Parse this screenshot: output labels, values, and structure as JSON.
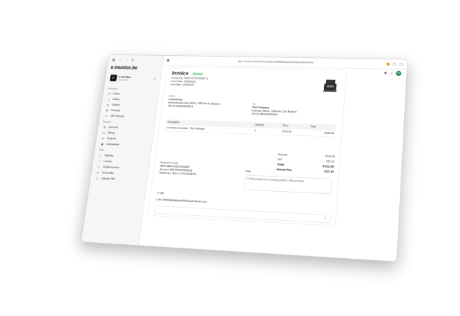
{
  "app": {
    "brand": "e-invoice.be",
    "org_name": "e-invoice",
    "org_sub": "@einvoicebe"
  },
  "sidebar": {
    "company_label": "Company",
    "company": [
      "Inbox",
      "Drafts",
      "Outbox",
      "Settings",
      "API Settings"
    ],
    "account_label": "Account",
    "account": [
      "General",
      "Billing",
      "Support",
      "Companies"
    ],
    "tools_label": "Tools",
    "tools": [
      "Validate",
      "Lookup",
      "Create invoice",
      "Send UBL",
      "Upload PDF"
    ]
  },
  "topbar": {
    "url": "app.e-invoice.be/documents/doc-1f4db9dacgkderso0fqu2uaihulkmbe",
    "avatar": "W"
  },
  "invoice": {
    "title": "Invoice",
    "status": "Received",
    "number": "Invoice No: TEST-1747223446771",
    "issue": "Issue Date: 14/05/2025",
    "due": "Due Date: 14/05/2025",
    "from_label": "From",
    "from_name": "e-invoice.be",
    "from_addr": "Brusselsesteenweg 119/A, 1980 Zemst, Belgium",
    "from_vat": "VAT ID: BE1018265814",
    "to_label": "To",
    "to_name": "Test Company",
    "to_addr": "Unknown Street, Unknown City, Belgium",
    "to_vat": "VAT ID: BE1018265814",
    "col_desc": "Description",
    "col_qty": "Quantity",
    "col_price": "Price",
    "col_total": "Total",
    "item_desc": "e-invoice.be credits - Test Package",
    "item_qty": "1",
    "item_price": "€100.00",
    "item_total": "€100.00",
    "subtotal_label": "Subtotal",
    "subtotal": "€100.00",
    "vat_label": "VAT",
    "vat": "€21.00",
    "total_label": "Total",
    "total": "€121.00",
    "due_label": "Amount Due",
    "amount_due": "€121.00",
    "pay_label": "Payment Details",
    "iban": "IBAN: BE44735070450845",
    "account": "Account: BE44735070450845",
    "reference": "Reference: TEST-1747223446771",
    "note_label": "Note",
    "note": "Credit purchase for e-invoicing platform. Paid via Stripe",
    "ubl_label": "UBL",
    "ubl_file": "doc-1f4db9dacgkderso0fqu2uaihulkmbe.xml"
  }
}
